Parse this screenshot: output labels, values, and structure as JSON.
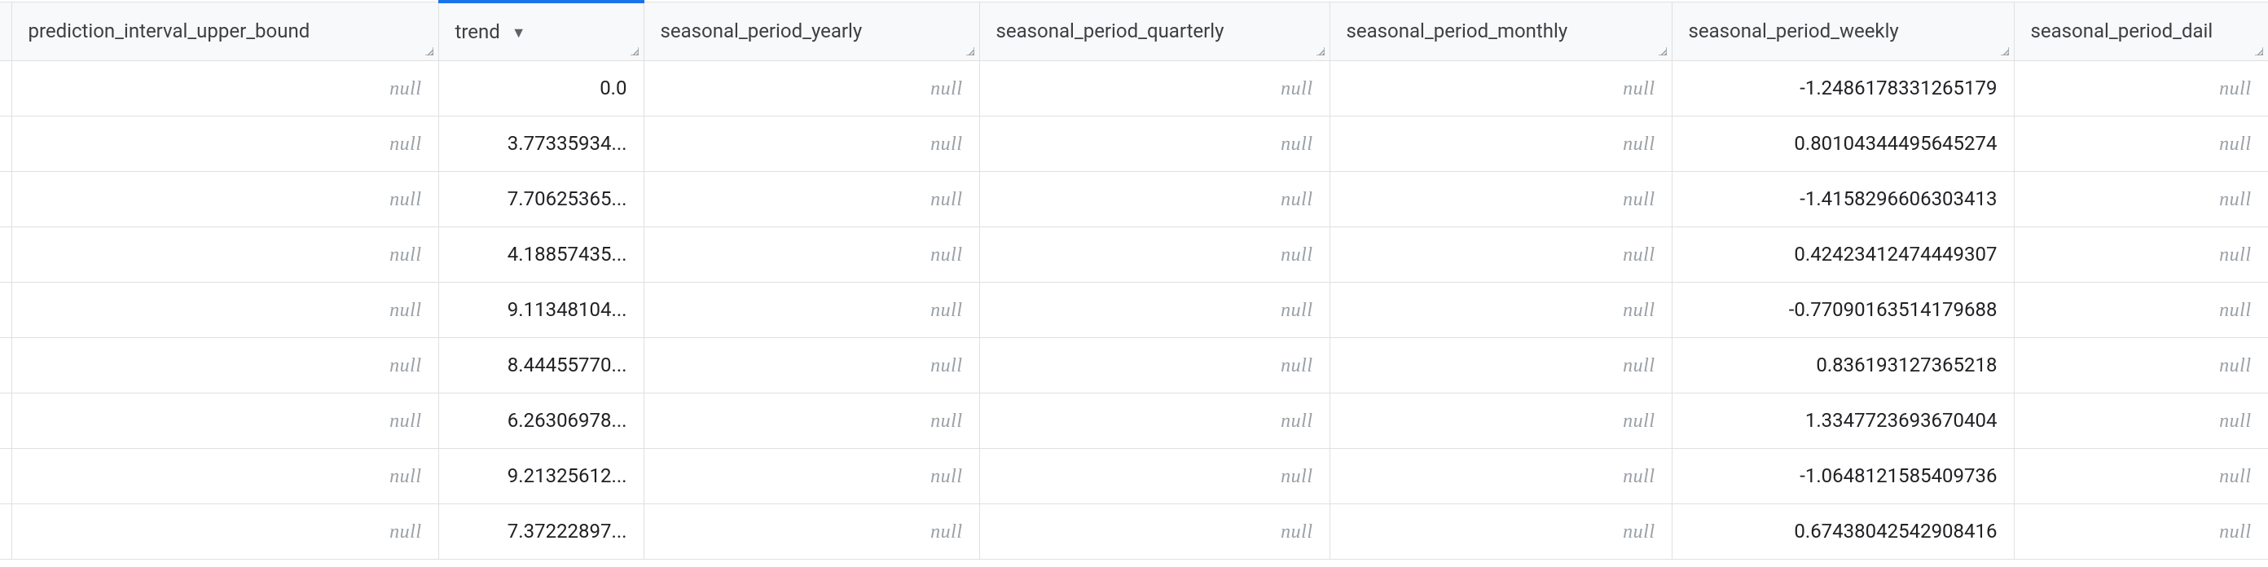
{
  "null_label": "null",
  "columns": [
    {
      "key": "prediction_interval_upper_bound",
      "label": "prediction_interval_upper_bound",
      "sorted": false,
      "sort_dir": ""
    },
    {
      "key": "trend",
      "label": "trend",
      "sorted": true,
      "sort_dir": "desc"
    },
    {
      "key": "seasonal_period_yearly",
      "label": "seasonal_period_yearly",
      "sorted": false,
      "sort_dir": ""
    },
    {
      "key": "seasonal_period_quarterly",
      "label": "seasonal_period_quarterly",
      "sorted": false,
      "sort_dir": ""
    },
    {
      "key": "seasonal_period_monthly",
      "label": "seasonal_period_monthly",
      "sorted": false,
      "sort_dir": ""
    },
    {
      "key": "seasonal_period_weekly",
      "label": "seasonal_period_weekly",
      "sorted": false,
      "sort_dir": ""
    },
    {
      "key": "seasonal_period_daily",
      "label": "seasonal_period_dail",
      "sorted": false,
      "sort_dir": "",
      "truncated": true
    }
  ],
  "rows": [
    {
      "prediction_interval_upper_bound": null,
      "trend": "0.0",
      "seasonal_period_yearly": null,
      "seasonal_period_quarterly": null,
      "seasonal_period_monthly": null,
      "seasonal_period_weekly": "-1.2486178331265179",
      "seasonal_period_daily": null
    },
    {
      "prediction_interval_upper_bound": null,
      "trend": "3.77335934...",
      "seasonal_period_yearly": null,
      "seasonal_period_quarterly": null,
      "seasonal_period_monthly": null,
      "seasonal_period_weekly": "0.80104344495645274",
      "seasonal_period_daily": null
    },
    {
      "prediction_interval_upper_bound": null,
      "trend": "7.70625365...",
      "seasonal_period_yearly": null,
      "seasonal_period_quarterly": null,
      "seasonal_period_monthly": null,
      "seasonal_period_weekly": "-1.4158296606303413",
      "seasonal_period_daily": null
    },
    {
      "prediction_interval_upper_bound": null,
      "trend": "4.18857435...",
      "seasonal_period_yearly": null,
      "seasonal_period_quarterly": null,
      "seasonal_period_monthly": null,
      "seasonal_period_weekly": "0.42423412474449307",
      "seasonal_period_daily": null
    },
    {
      "prediction_interval_upper_bound": null,
      "trend": "9.11348104...",
      "seasonal_period_yearly": null,
      "seasonal_period_quarterly": null,
      "seasonal_period_monthly": null,
      "seasonal_period_weekly": "-0.77090163514179688",
      "seasonal_period_daily": null
    },
    {
      "prediction_interval_upper_bound": null,
      "trend": "8.44455770...",
      "seasonal_period_yearly": null,
      "seasonal_period_quarterly": null,
      "seasonal_period_monthly": null,
      "seasonal_period_weekly": "0.836193127365218",
      "seasonal_period_daily": null
    },
    {
      "prediction_interval_upper_bound": null,
      "trend": "6.26306978...",
      "seasonal_period_yearly": null,
      "seasonal_period_quarterly": null,
      "seasonal_period_monthly": null,
      "seasonal_period_weekly": "1.3347723693670404",
      "seasonal_period_daily": null
    },
    {
      "prediction_interval_upper_bound": null,
      "trend": "9.21325612...",
      "seasonal_period_yearly": null,
      "seasonal_period_quarterly": null,
      "seasonal_period_monthly": null,
      "seasonal_period_weekly": "-1.0648121585409736",
      "seasonal_period_daily": null
    },
    {
      "prediction_interval_upper_bound": null,
      "trend": "7.37222897...",
      "seasonal_period_yearly": null,
      "seasonal_period_quarterly": null,
      "seasonal_period_monthly": null,
      "seasonal_period_weekly": "0.67438042542908416",
      "seasonal_period_daily": null
    }
  ]
}
